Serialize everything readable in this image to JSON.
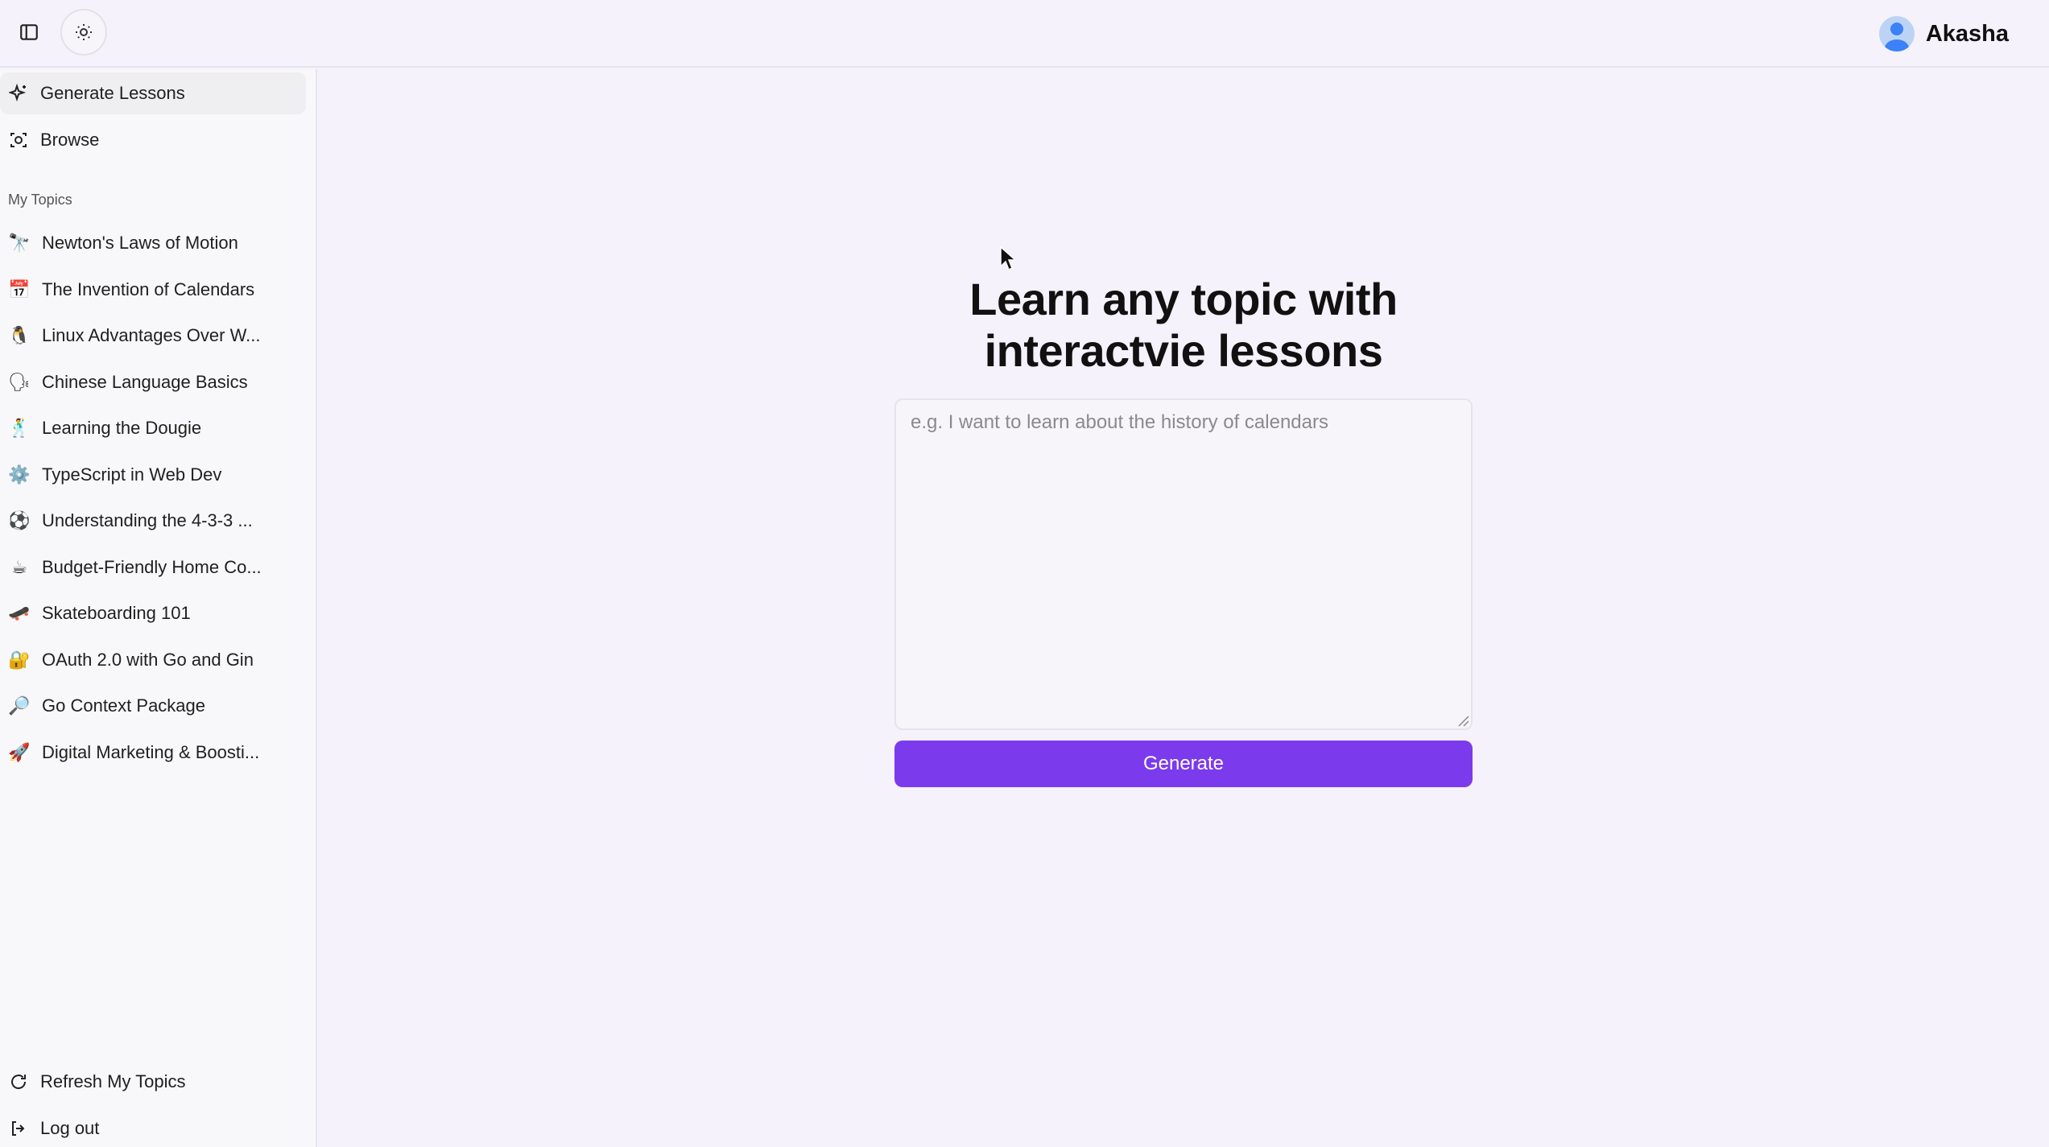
{
  "header": {
    "user_name": "Akasha"
  },
  "sidebar": {
    "nav": [
      {
        "label": "Generate Lessons",
        "icon": "sparkles-icon",
        "active": true
      },
      {
        "label": "Browse",
        "icon": "browse-icon",
        "active": false
      }
    ],
    "section_label": "My Topics",
    "topics": [
      {
        "emoji": "🔭",
        "label": "Newton's Laws of Motion"
      },
      {
        "emoji": "📅",
        "label": "The Invention of Calendars"
      },
      {
        "emoji": "🐧",
        "label": "Linux Advantages Over W..."
      },
      {
        "emoji": "🗣",
        "label": "Chinese Language Basics"
      },
      {
        "emoji": "🕺",
        "label": "Learning the Dougie"
      },
      {
        "emoji": "⚙️",
        "label": "TypeScript in Web Dev"
      },
      {
        "emoji": "⚽",
        "label": "Understanding the 4-3-3 ..."
      },
      {
        "emoji": "☕",
        "label": "Budget-Friendly Home Co..."
      },
      {
        "emoji": "🛹",
        "label": "Skateboarding 101"
      },
      {
        "emoji": "🔐",
        "label": "OAuth 2.0 with Go and Gin"
      },
      {
        "emoji": "🔎",
        "label": "Go Context Package"
      },
      {
        "emoji": "🚀",
        "label": "Digital Marketing & Boosti..."
      }
    ],
    "footer": [
      {
        "label": "Refresh My Topics",
        "icon": "refresh-icon"
      },
      {
        "label": "Log out",
        "icon": "logout-icon"
      }
    ]
  },
  "main": {
    "title_line1": "Learn any topic with",
    "title_line2": "interactvie lessons",
    "prompt_placeholder": "e.g. I want to learn about the history of calendars",
    "prompt_value": "",
    "generate_label": "Generate"
  },
  "colors": {
    "accent": "#7c3aed",
    "background": "#f5f2fb"
  }
}
